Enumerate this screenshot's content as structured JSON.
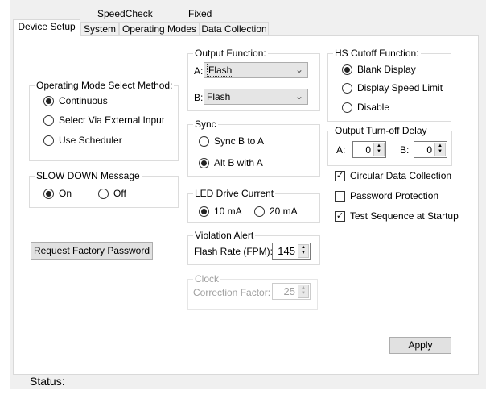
{
  "header": {
    "left": "SpeedCheck",
    "right": "Fixed"
  },
  "tabs": [
    "Device Setup",
    "System",
    "Operating Modes",
    "Data Collection"
  ],
  "operating_mode": {
    "title": "Operating Mode Select Method:",
    "options": [
      "Continuous",
      "Select Via External Input",
      "Use Scheduler"
    ],
    "selected": 0
  },
  "slow_down": {
    "title": "SLOW DOWN Message",
    "options": [
      "On",
      "Off"
    ],
    "selected": 0
  },
  "request_password_label": "Request Factory Password",
  "output_function": {
    "title": "Output Function:",
    "a_label": "A:",
    "a_value": "Flash",
    "b_label": "B:",
    "b_value": "Flash"
  },
  "sync": {
    "title": "Sync",
    "options": [
      "Sync B to A",
      "Alt B with A"
    ],
    "selected": 1
  },
  "led": {
    "title": "LED Drive Current",
    "options": [
      "10 mA",
      "20 mA"
    ],
    "selected": 0
  },
  "violation": {
    "title": "Violation Alert",
    "label": "Flash Rate (FPM):",
    "value": "145"
  },
  "clock": {
    "title": "Clock",
    "label": "Correction Factor:",
    "value": "25"
  },
  "hs_cutoff": {
    "title": "HS Cutoff Function:",
    "options": [
      "Blank Display",
      "Display Speed Limit",
      "Disable"
    ],
    "selected": 0
  },
  "turnoff": {
    "title": "Output Turn-off Delay",
    "a_label": "A:",
    "a_value": "0",
    "b_label": "B:",
    "b_value": "0"
  },
  "checkboxes": [
    {
      "label": "Circular Data Collection",
      "checked": true
    },
    {
      "label": "Password Protection",
      "checked": false
    },
    {
      "label": "Test Sequence at Startup",
      "checked": true
    }
  ],
  "apply_label": "Apply",
  "status_label": "Status:"
}
